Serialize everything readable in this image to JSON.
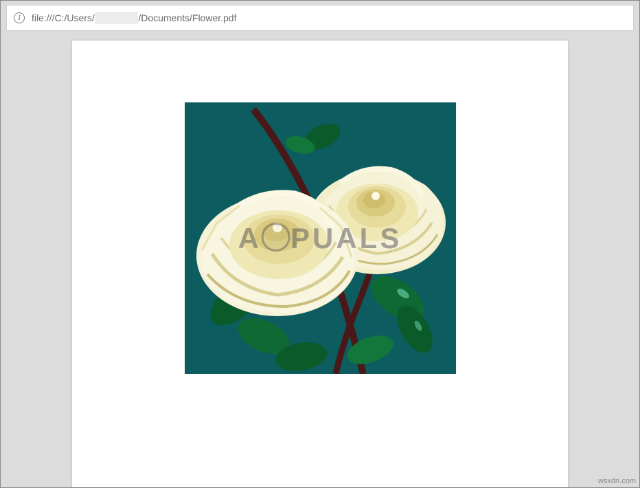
{
  "address_bar": {
    "url_prefix": "file:///C:/Users/",
    "url_redacted": "██████",
    "url_suffix": "/Documents/Flower.pdf"
  },
  "watermark": {
    "prefix": "A",
    "suffix": "PUALS"
  },
  "attribution": "wsxdn.com",
  "content": {
    "description": "flower-illustration-white-roses",
    "background_color": "#0d5c60"
  }
}
